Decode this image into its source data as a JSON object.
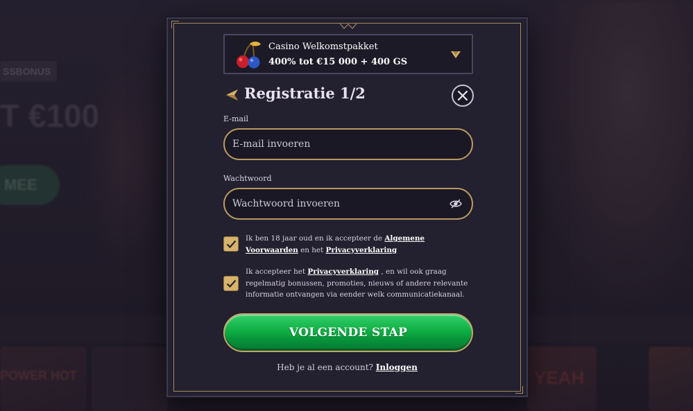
{
  "background": {
    "badge": "SSBONUS",
    "amount": "T €100",
    "button": "MEE",
    "game_tiles": [
      "POWER HOT",
      "YEAH"
    ]
  },
  "promo": {
    "title": "Casino Welkomstpakket",
    "subtitle": "400% tot €15 000 + 400 GS",
    "icon": "cherries-icon",
    "chevron": "chevron-down-icon"
  },
  "header": {
    "title": "Registratie 1/2",
    "back_icon": "arrow-left-icon",
    "close_icon": "close-icon"
  },
  "form": {
    "email_label": "E-mail",
    "email_placeholder": "E-mail invoeren",
    "email_value": "",
    "password_label": "Wachtwoord",
    "password_placeholder": "Wachtwoord invoeren",
    "password_value": "",
    "password_toggle_icon": "eye-slash-icon"
  },
  "consents": {
    "terms": {
      "checked": true,
      "text_before": "Ik ben 18 jaar oud en ik accepteer de ",
      "link_terms": "Algemene Voorwaarden",
      "text_middle": " en het ",
      "link_privacy": "Privacyverklaring"
    },
    "marketing": {
      "checked": true,
      "text_before": "Ik accepteer het ",
      "link_privacy": "Privacyverklaring",
      "text_after": " , en wil ook graag regelmatig bonussen, promoties, nieuws of andere relevante informatie ontvangen via eender welk communicatiekanaal."
    }
  },
  "cta": {
    "label": "VOLGENDE STAP"
  },
  "footer": {
    "text": "Heb je al een account? ",
    "link": "Inloggen"
  },
  "colors": {
    "gold": "#b79a62",
    "checkbox": "#d7b46a",
    "cta_green": "#0fae44",
    "modal_bg": "#23202f"
  }
}
